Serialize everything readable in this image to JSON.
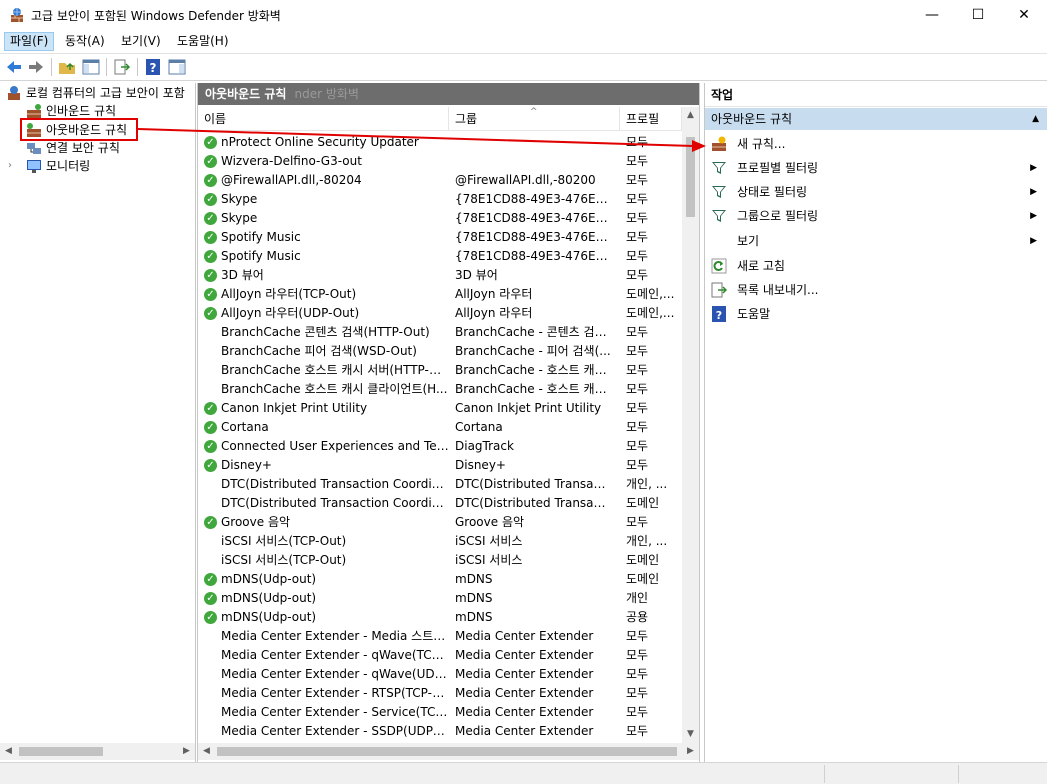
{
  "window": {
    "title": "고급 보안이 포함된 Windows Defender 방화벽",
    "minimize": "—",
    "maximize": "☐",
    "close": "✕"
  },
  "menu": [
    "파일(F)",
    "동작(A)",
    "보기(V)",
    "도움말(H)"
  ],
  "tree": {
    "root": "로컬 컴퓨터의 고급 보안이 포함",
    "items": [
      "인바운드 규칙",
      "아웃바운드 규칙",
      "연결 보안 규칙",
      "모니터링"
    ]
  },
  "center": {
    "header": "아웃바운드 규칙",
    "ghost_header": "nder 방화벽",
    "columns": [
      "이름",
      "그룹",
      "프로필"
    ],
    "rows": [
      {
        "enabled": true,
        "name": "nProtect Online Security Updater",
        "group": "",
        "profile": "모두"
      },
      {
        "enabled": true,
        "name": "Wizvera-Delfino-G3-out",
        "group": "",
        "profile": "모두"
      },
      {
        "enabled": true,
        "name": "@FirewallAPI.dll,-80204",
        "group": "@FirewallAPI.dll,-80200",
        "profile": "모두"
      },
      {
        "enabled": true,
        "name": "Skype",
        "group": "{78E1CD88-49E3-476E-B9...",
        "profile": "모두"
      },
      {
        "enabled": true,
        "name": "Skype",
        "group": "{78E1CD88-49E3-476E-B9...",
        "profile": "모두"
      },
      {
        "enabled": true,
        "name": "Spotify Music",
        "group": "{78E1CD88-49E3-476E-B9...",
        "profile": "모두"
      },
      {
        "enabled": true,
        "name": "Spotify Music",
        "group": "{78E1CD88-49E3-476E-B9...",
        "profile": "모두"
      },
      {
        "enabled": true,
        "name": "3D 뷰어",
        "group": "3D 뷰어",
        "profile": "모두"
      },
      {
        "enabled": true,
        "name": "AllJoyn 라우터(TCP-Out)",
        "group": "AllJoyn 라우터",
        "profile": "도메인,..."
      },
      {
        "enabled": true,
        "name": "AllJoyn 라우터(UDP-Out)",
        "group": "AllJoyn 라우터",
        "profile": "도메인,..."
      },
      {
        "enabled": false,
        "name": "BranchCache 콘텐츠 검색(HTTP-Out)",
        "group": "BranchCache - 콘텐츠 검색...",
        "profile": "모두"
      },
      {
        "enabled": false,
        "name": "BranchCache 피어 검색(WSD-Out)",
        "group": "BranchCache - 피어 검색(...",
        "profile": "모두"
      },
      {
        "enabled": false,
        "name": "BranchCache 호스트 캐시 서버(HTTP-O...",
        "group": "BranchCache - 호스트 캐시...",
        "profile": "모두"
      },
      {
        "enabled": false,
        "name": "BranchCache 호스트 캐시 클라이언트(H...",
        "group": "BranchCache - 호스트 캐시...",
        "profile": "모두"
      },
      {
        "enabled": true,
        "name": "Canon Inkjet Print Utility",
        "group": "Canon Inkjet Print Utility",
        "profile": "모두"
      },
      {
        "enabled": true,
        "name": "Cortana",
        "group": "Cortana",
        "profile": "모두"
      },
      {
        "enabled": true,
        "name": "Connected User Experiences and Teleme...",
        "group": "DiagTrack",
        "profile": "모두"
      },
      {
        "enabled": true,
        "name": "Disney+",
        "group": "Disney+",
        "profile": "모두"
      },
      {
        "enabled": false,
        "name": "DTC(Distributed Transaction Coordinato...",
        "group": "DTC(Distributed Transactio...",
        "profile": "개인, ..."
      },
      {
        "enabled": false,
        "name": "DTC(Distributed Transaction Coordinato...",
        "group": "DTC(Distributed Transactio...",
        "profile": "도메인"
      },
      {
        "enabled": true,
        "name": "Groove 음악",
        "group": "Groove 음악",
        "profile": "모두"
      },
      {
        "enabled": false,
        "name": "iSCSI 서비스(TCP-Out)",
        "group": "iSCSI 서비스",
        "profile": "개인, ..."
      },
      {
        "enabled": false,
        "name": "iSCSI 서비스(TCP-Out)",
        "group": "iSCSI 서비스",
        "profile": "도메인"
      },
      {
        "enabled": true,
        "name": "mDNS(Udp-out)",
        "group": "mDNS",
        "profile": "도메인"
      },
      {
        "enabled": true,
        "name": "mDNS(Udp-out)",
        "group": "mDNS",
        "profile": "개인"
      },
      {
        "enabled": true,
        "name": "mDNS(Udp-out)",
        "group": "mDNS",
        "profile": "공용"
      },
      {
        "enabled": false,
        "name": "Media Center Extender - Media 스트리...",
        "group": "Media Center Extender",
        "profile": "모두"
      },
      {
        "enabled": false,
        "name": "Media Center Extender - qWave(TCP-Out)",
        "group": "Media Center Extender",
        "profile": "모두"
      },
      {
        "enabled": false,
        "name": "Media Center Extender - qWave(UDP-O...",
        "group": "Media Center Extender",
        "profile": "모두"
      },
      {
        "enabled": false,
        "name": "Media Center Extender - RTSP(TCP-Out)",
        "group": "Media Center Extender",
        "profile": "모두"
      },
      {
        "enabled": false,
        "name": "Media Center Extender - Service(TCP-O...",
        "group": "Media Center Extender",
        "profile": "모두"
      },
      {
        "enabled": false,
        "name": "Media Center Extender - SSDP(UDP-Out)",
        "group": "Media Center Extender",
        "profile": "모두"
      }
    ]
  },
  "actions": {
    "title": "작업",
    "section": "아웃바운드 규칙",
    "items": [
      {
        "label": "새 규칙...",
        "icon": "new-rule-icon",
        "submenu": false
      },
      {
        "label": "프로필별 필터링",
        "icon": "filter-icon",
        "submenu": true
      },
      {
        "label": "상태로 필터링",
        "icon": "filter-icon",
        "submenu": true
      },
      {
        "label": "그룹으로 필터링",
        "icon": "filter-icon",
        "submenu": true
      },
      {
        "label": "보기",
        "icon": "",
        "submenu": true
      },
      {
        "label": "새로 고침",
        "icon": "refresh-icon",
        "submenu": false
      },
      {
        "label": "목록 내보내기...",
        "icon": "export-list-icon",
        "submenu": false
      },
      {
        "label": "도움말",
        "icon": "help-icon",
        "submenu": false
      }
    ]
  },
  "colors": {
    "accent_red": "#e00000",
    "section_bg": "#c8dcef",
    "header_bg": "#6d6d6d",
    "check_green": "#3fa73c"
  }
}
